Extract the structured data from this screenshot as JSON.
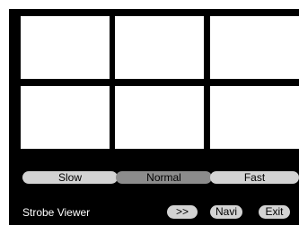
{
  "app": {
    "title": "Strobe Viewer"
  },
  "frames": [
    {
      "id": 1
    },
    {
      "id": 2
    },
    {
      "id": 3
    },
    {
      "id": 4
    },
    {
      "id": 5
    },
    {
      "id": 6
    }
  ],
  "speed": {
    "options": [
      "Slow",
      "Normal",
      "Fast"
    ],
    "selected": "Normal"
  },
  "controls": {
    "next_label": ">>",
    "navi_label": "Navi",
    "exit_label": "Exit"
  },
  "colors": {
    "background": "#000000",
    "frame": "#ffffff",
    "button": "#d3d3d3",
    "button_selected": "#8c8c8c"
  }
}
